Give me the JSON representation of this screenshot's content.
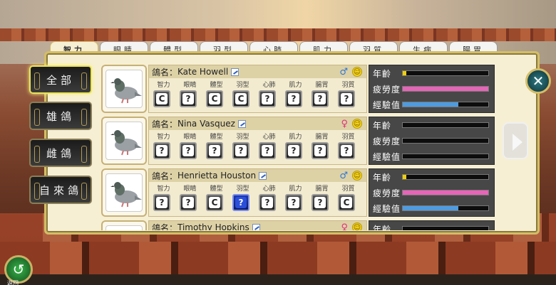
{
  "tabs": [
    "智力",
    "眼睛",
    "體型",
    "羽型",
    "心肺",
    "肌力",
    "羽質",
    "生病",
    "腸胃"
  ],
  "filters": [
    "全部",
    "雄鴿",
    "雌鴿",
    "自來鴿"
  ],
  "trait_labels": [
    "智力",
    "眼睛",
    "體型",
    "羽型",
    "心肺",
    "肌力",
    "腸胃",
    "羽質"
  ],
  "stat_labels": [
    "年齡",
    "疲勞度",
    "經驗值"
  ],
  "name_prefix": "鴿名：",
  "pigeons": [
    {
      "name": "Kate Howell",
      "gender": "♂",
      "mood": "☺",
      "traits": [
        "C",
        "?",
        "C",
        "C",
        "?",
        "?",
        "?",
        "?"
      ],
      "age": 0.04,
      "fatigue": 1.0,
      "exp": 0.65
    },
    {
      "name": "Nina Vasquez",
      "gender": "♀",
      "mood": "☺",
      "traits": [
        "?",
        "?",
        "?",
        "?",
        "?",
        "?",
        "?",
        "?"
      ],
      "age": 0,
      "fatigue": 0,
      "exp": 0
    },
    {
      "name": "Henrietta Houston",
      "gender": "♂",
      "mood": "☺",
      "traits": [
        "?",
        "?",
        "C",
        "?",
        "?",
        "?",
        "?",
        "C"
      ],
      "age": 0.04,
      "fatigue": 1.0,
      "exp": 0.65
    },
    {
      "name": "Timothy Hopkins",
      "gender": "♀",
      "mood": "☺",
      "traits": [],
      "age": 0,
      "fatigue": 0,
      "exp": 0
    }
  ],
  "colors": {
    "age": "#f0d000",
    "fatigue": "#e864b8",
    "exp": "#4f9be0",
    "male": "#2d77d6",
    "female": "#e0307a",
    "highlight_badge": "#2b4fd8"
  },
  "buttons": {
    "close": "✕",
    "back": "↺",
    "back_label": "返回"
  }
}
